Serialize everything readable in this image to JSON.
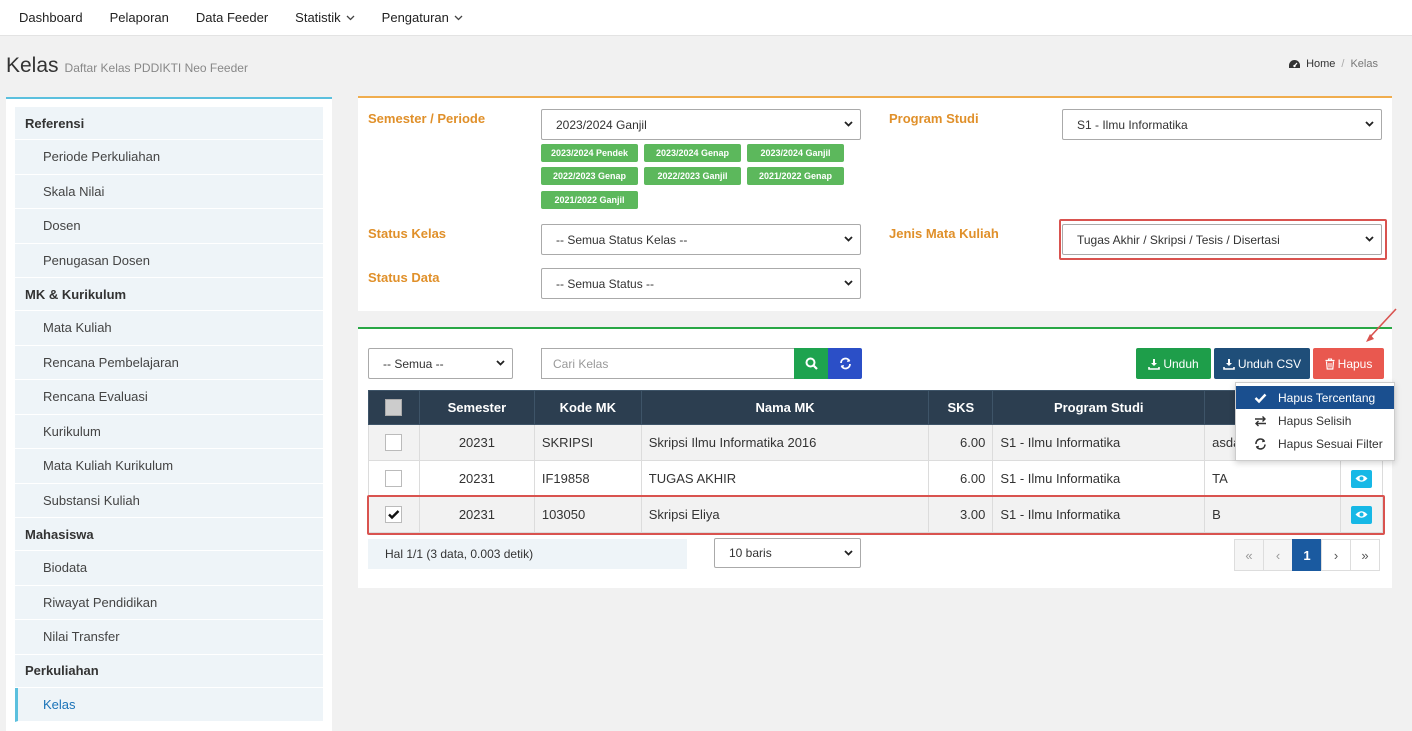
{
  "nav": {
    "items": [
      {
        "label": "Dashboard",
        "dropdown": false
      },
      {
        "label": "Pelaporan",
        "dropdown": false
      },
      {
        "label": "Data Feeder",
        "dropdown": false
      },
      {
        "label": "Statistik",
        "dropdown": true
      },
      {
        "label": "Pengaturan",
        "dropdown": true
      }
    ]
  },
  "page": {
    "title": "Kelas",
    "subtitle": "Daftar Kelas PDDIKTI Neo Feeder",
    "breadcrumb": {
      "home": "Home",
      "current": "Kelas"
    }
  },
  "sidebar": {
    "groups": [
      {
        "label": "Referensi",
        "items": [
          "Periode Perkuliahan",
          "Skala Nilai",
          "Dosen",
          "Penugasan Dosen"
        ]
      },
      {
        "label": "MK & Kurikulum",
        "items": [
          "Mata Kuliah",
          "Rencana Pembelajaran",
          "Rencana Evaluasi",
          "Kurikulum",
          "Mata Kuliah Kurikulum",
          "Substansi Kuliah"
        ]
      },
      {
        "label": "Mahasiswa",
        "items": [
          "Biodata",
          "Riwayat Pendidikan",
          "Nilai Transfer"
        ]
      },
      {
        "label": "Perkuliahan",
        "items": [
          "Kelas"
        ]
      }
    ],
    "active_item": "Kelas"
  },
  "filters": {
    "semester_label": "Semester / Periode",
    "semester_value": "2023/2024 Ganjil",
    "semester_chips": [
      "2023/2024 Pendek",
      "2023/2024 Genap",
      "2023/2024 Ganjil",
      "2022/2023 Genap",
      "2022/2023 Ganjil",
      "2021/2022 Genap",
      "2021/2022 Ganjil"
    ],
    "prodi_label": "Program Studi",
    "prodi_value": "S1 - Ilmu Informatika",
    "status_kelas_label": "Status Kelas",
    "status_kelas_value": "-- Semua Status Kelas --",
    "jenis_mk_label": "Jenis Mata Kuliah",
    "jenis_mk_value": "Tugas Akhir / Skripsi / Tesis / Disertasi",
    "status_data_label": "Status Data",
    "status_data_value": "-- Semua Status --"
  },
  "toolbar": {
    "scope_value": "-- Semua --",
    "search_placeholder": "Cari Kelas",
    "unduh_label": "Unduh",
    "unduh_csv_label": "Unduh CSV",
    "hapus_label": "Hapus"
  },
  "hapus_menu": {
    "items": [
      {
        "label": "Hapus Tercentang",
        "icon": "check-icon",
        "active": true
      },
      {
        "label": "Hapus Selisih",
        "icon": "swap-icon",
        "active": false
      },
      {
        "label": "Hapus Sesuai Filter",
        "icon": "refresh-icon",
        "active": false
      }
    ]
  },
  "table": {
    "headers": [
      "Semester",
      "Kode MK",
      "Nama MK",
      "SKS",
      "Program Studi"
    ],
    "rows": [
      {
        "checked": false,
        "semester": "20231",
        "kode": "SKRIPSI",
        "nama": "Skripsi Ilmu Informatika 2016",
        "sks": "6.00",
        "prodi": "S1 - Ilmu Informatika",
        "kelas": "asda"
      },
      {
        "checked": false,
        "semester": "20231",
        "kode": "IF19858",
        "nama": "TUGAS AKHIR",
        "sks": "6.00",
        "prodi": "S1 - Ilmu Informatika",
        "kelas": "TA"
      },
      {
        "checked": true,
        "semester": "20231",
        "kode": "103050",
        "nama": "Skripsi Eliya",
        "sks": "3.00",
        "prodi": "S1 - Ilmu Informatika",
        "kelas": "B"
      }
    ]
  },
  "footer": {
    "status_text": "Hal 1/1 (3 data, 0.003 detik)",
    "rows_per_page": "10 baris",
    "pager": {
      "first": "«",
      "prev": "‹",
      "current": "1",
      "next": "›",
      "last": "»"
    }
  },
  "colors": {
    "filter_label": "#e0902a",
    "chip_green": "#5cb85c",
    "header_dark": "#2c3e50",
    "hapus_red": "#e9584f",
    "unduh_green": "#1e9e4a",
    "unduh_csv_navy": "#1f4e79",
    "highlight_red": "#d9534f"
  }
}
